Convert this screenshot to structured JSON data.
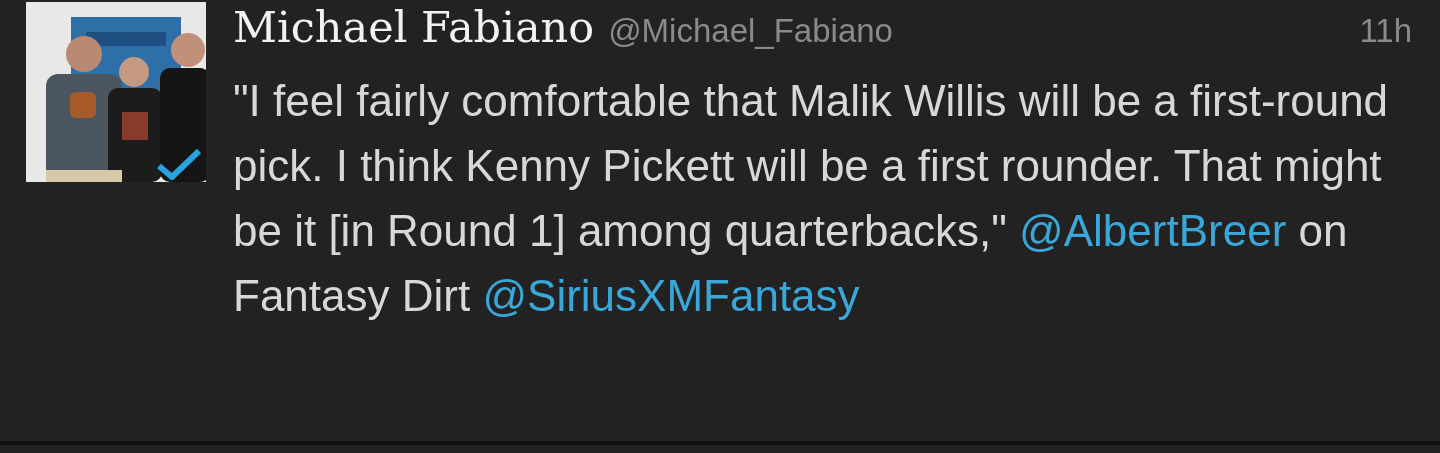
{
  "tweet": {
    "author": {
      "name": "Michael Fabiano",
      "handle": "@Michael_Fabiano",
      "verified": true
    },
    "time": "11h",
    "body": [
      {
        "kind": "text",
        "text": "\"I feel fairly comfortable that Malik Willis will be a first-round pick. I think Kenny Pickett will be a first rounder. That might be it [in Round 1] among quarterbacks,\" "
      },
      {
        "kind": "mention",
        "text": "@AlbertBreer"
      },
      {
        "kind": "text",
        "text": " on Fantasy Dirt "
      },
      {
        "kind": "mention",
        "text": "@SiriusXMFantasy"
      }
    ]
  }
}
